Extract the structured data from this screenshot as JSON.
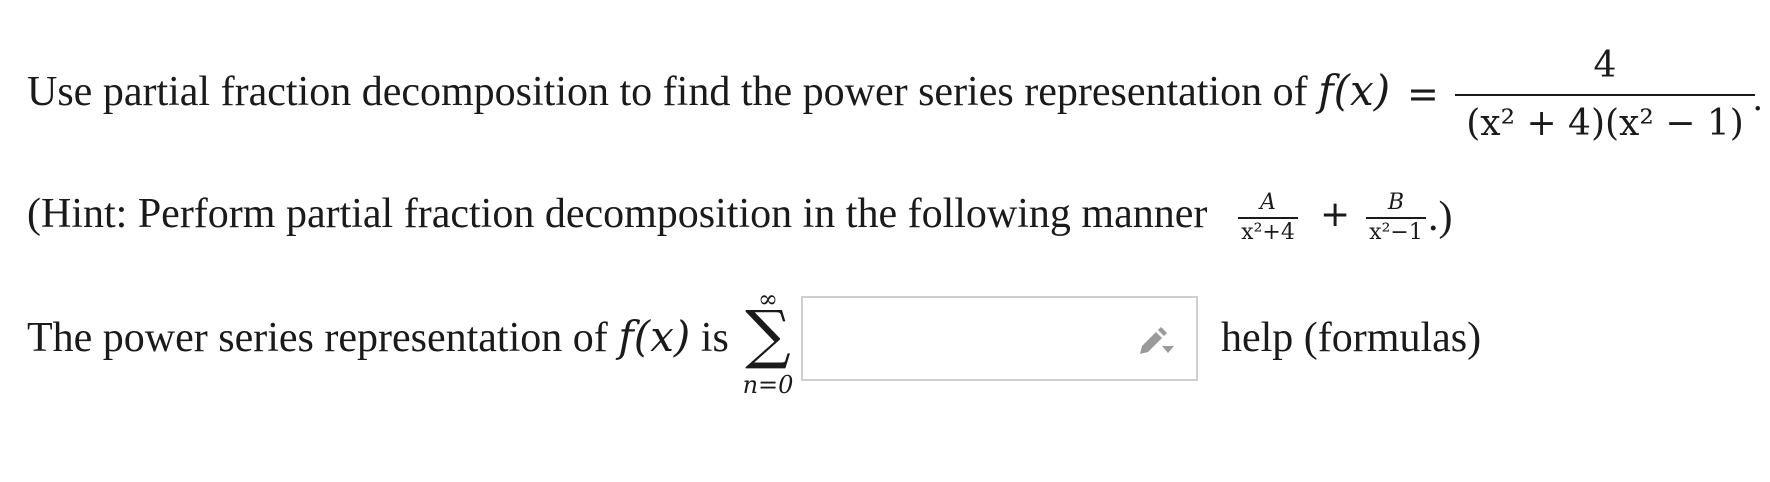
{
  "line1": {
    "prefix": "Use partial fraction decomposition to find the power series representation of",
    "func": "f(x)",
    "equals": "=",
    "numerator": "4",
    "denominator": "(x² + 4)(x² − 1)",
    "period": "."
  },
  "line2": {
    "prefix": "(Hint: Perform partial fraction decomposition in the following manner",
    "frac_a_num": "A",
    "frac_a_den": "x²+4",
    "plus": "+",
    "frac_b_num": "B",
    "frac_b_den": "x²−1",
    "suffix": ".)"
  },
  "line3": {
    "prefix": "The power series representation of",
    "func": "f(x)",
    "is": "is",
    "sum_upper": "∞",
    "sum_symbol": "∑",
    "sum_lower": "n=0",
    "answer_value": "",
    "help_link": "help (formulas)"
  },
  "icons": {
    "answer_icon": "pencil-dropdown-icon"
  },
  "colors": {
    "text": "#1a1a1a",
    "input_border": "#cfcfcf",
    "icon": "#9a9a9a"
  }
}
